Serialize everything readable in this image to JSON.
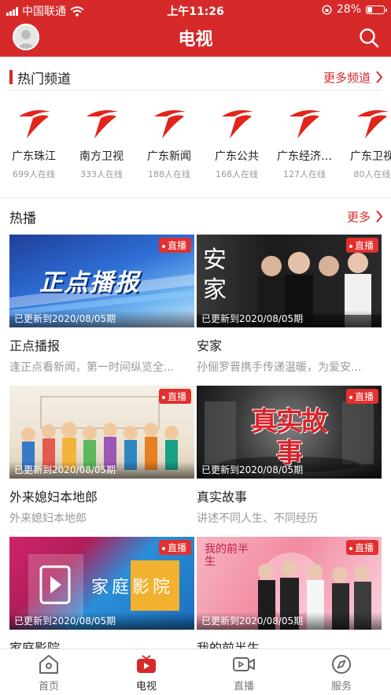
{
  "status_bar": {
    "carrier": "中国联通",
    "time": "上午11:26",
    "battery": "28%"
  },
  "header": {
    "title": "电视"
  },
  "hot_channels": {
    "title": "热门频道",
    "more": "更多频道",
    "items": [
      {
        "name": "广东珠江",
        "count": "699人在线"
      },
      {
        "name": "南方卫视",
        "count": "333人在线"
      },
      {
        "name": "广东新闻",
        "count": "188人在线"
      },
      {
        "name": "广东公共",
        "count": "168人在线"
      },
      {
        "name": "广东经济…",
        "count": "127人在线"
      },
      {
        "name": "广东卫视",
        "count": "80人在线"
      }
    ]
  },
  "hot_broadcast": {
    "title": "热播",
    "more": "更多",
    "live_label": "直播",
    "items": [
      {
        "title": "正点播报",
        "desc": "逢正点看新闻，第一时间纵览全...",
        "updated": "已更新到2020/08/05期",
        "thumb_text": "正点播报"
      },
      {
        "title": "安家",
        "desc": "孙俪罗晋携手传递温暖，为爱安...",
        "updated": "已更新到2020/08/05期",
        "thumb_text": "安家"
      },
      {
        "title": "外来媳妇本地郎",
        "desc": "外来媳妇本地郎",
        "updated": "已更新到2020/08/05期",
        "thumb_text": ""
      },
      {
        "title": "真实故事",
        "desc": "讲述不同人生、不同经历",
        "updated": "已更新到2020/08/05期",
        "thumb_text": "真实故事"
      },
      {
        "title": "家庭影院",
        "desc": "",
        "updated": "已更新到2020/08/05期",
        "thumb_text": "家庭影院"
      },
      {
        "title": "我的前半生",
        "desc": "",
        "updated": "已更新到2020/08/05期",
        "thumb_text": "我的前半生"
      }
    ]
  },
  "tabbar": {
    "items": [
      {
        "label": "首页",
        "icon": "home-icon"
      },
      {
        "label": "电视",
        "icon": "tv-icon"
      },
      {
        "label": "直播",
        "icon": "video-icon"
      },
      {
        "label": "服务",
        "icon": "compass-icon"
      }
    ],
    "active_index": 1
  },
  "colors": {
    "brand": "#d62a2a",
    "live_badge": "#e2302e"
  }
}
